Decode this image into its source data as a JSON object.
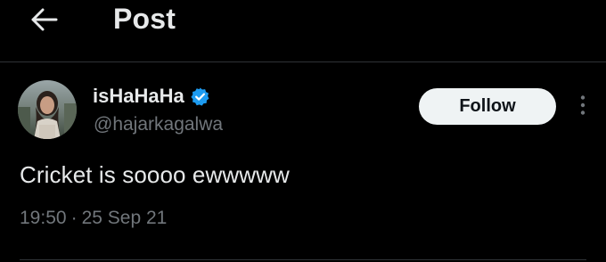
{
  "header": {
    "back_icon": "arrow-left-icon",
    "title": "Post"
  },
  "post": {
    "author": {
      "avatar_icon": "avatar-photo",
      "display_name": "isHaHaHa",
      "verified_icon": "verified-badge-icon",
      "handle": "@hajarkagalwa"
    },
    "follow_label": "Follow",
    "more_icon": "more-vertical-icon",
    "text": "Cricket is soooo ewwwww",
    "time": "19:50",
    "separator": "·",
    "date": "25 Sep 21"
  },
  "colors": {
    "background": "#000000",
    "primary_text": "#e7e9ea",
    "secondary_text": "#71767b",
    "verified": "#1d9bf0",
    "follow_bg": "#eff3f4",
    "divider": "#2f3336"
  }
}
